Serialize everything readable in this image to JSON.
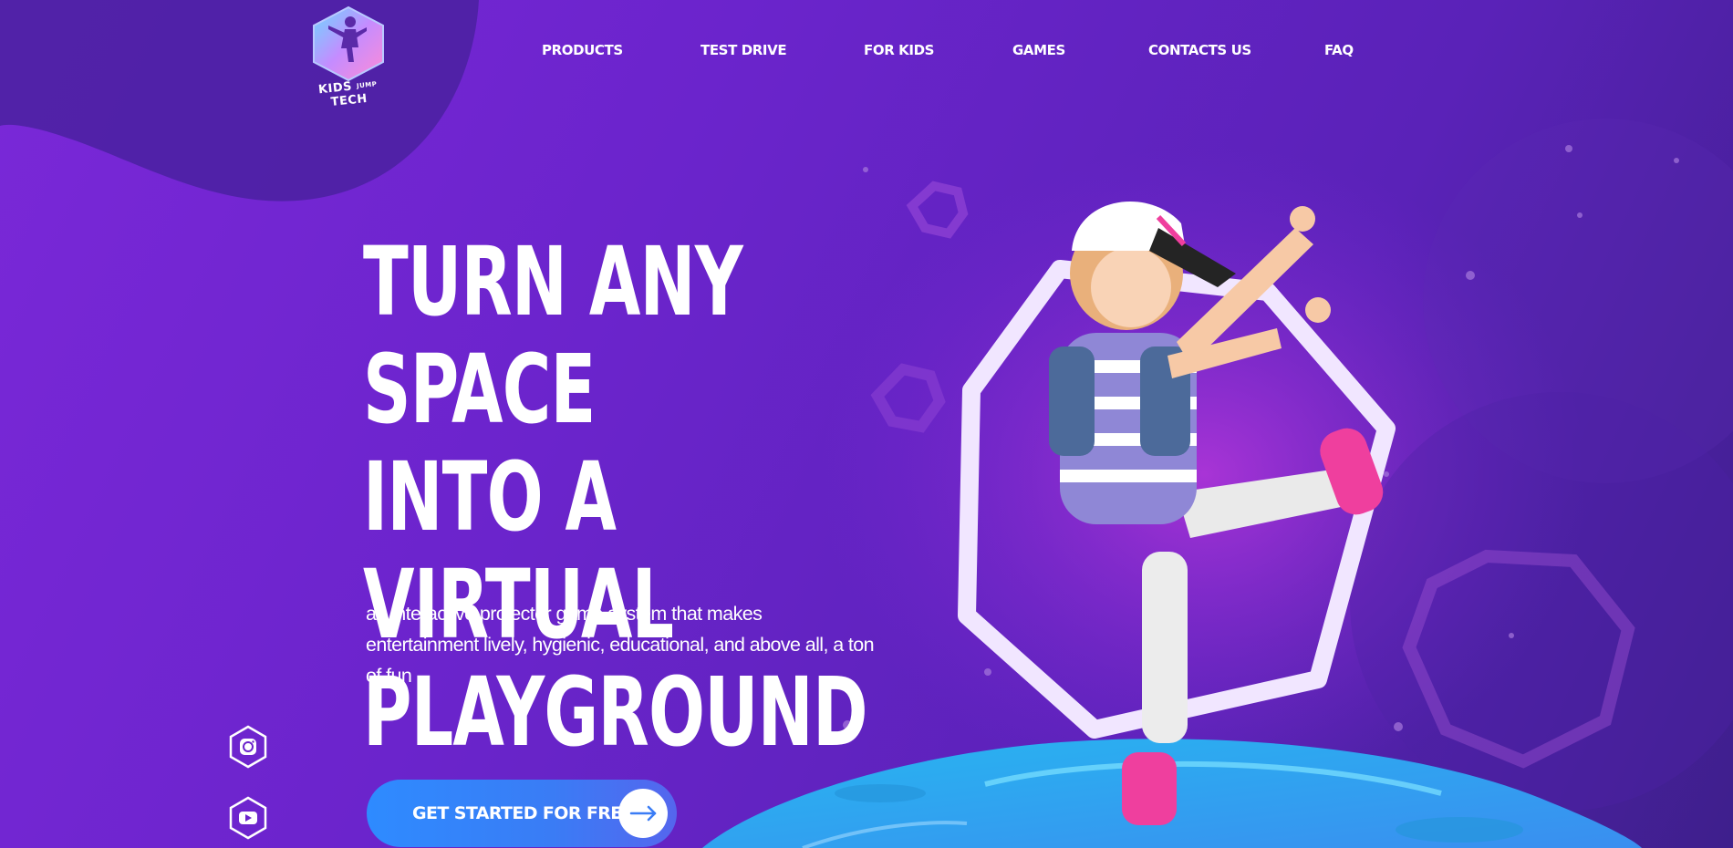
{
  "brand": {
    "logo_text_left": "KIDS",
    "logo_text_middle": "JUMP",
    "logo_text_right": "TECH",
    "logo_icon": "dancing-girl-hexagon-icon"
  },
  "nav": {
    "items": [
      {
        "label": "PRODUCTS"
      },
      {
        "label": "TEST DRIVE"
      },
      {
        "label": "FOR KIDS"
      },
      {
        "label": "GAMES"
      },
      {
        "label": "CONTACTS US"
      },
      {
        "label": "FAQ"
      }
    ]
  },
  "hero": {
    "headline_lines": [
      "TURN ANY SPACE",
      "INTO A VIRTUAL",
      "PLAYGROUND"
    ],
    "subtitle": "an interactive projector game system that makes entertainment lively, hygienic, educational, and above all, a ton of fun",
    "cta_label": "GET STARTED FOR FREE",
    "cta_icon": "arrow-right-icon"
  },
  "social": [
    {
      "icon": "instagram-icon"
    },
    {
      "icon": "youtube-icon"
    }
  ],
  "colors": {
    "background_start": "#7a28d8",
    "background_end": "#3e1f8c",
    "cta_start": "#2e8bff",
    "cta_end": "#5566ee",
    "platform": "#2fc8f0",
    "text": "#ffffff"
  }
}
